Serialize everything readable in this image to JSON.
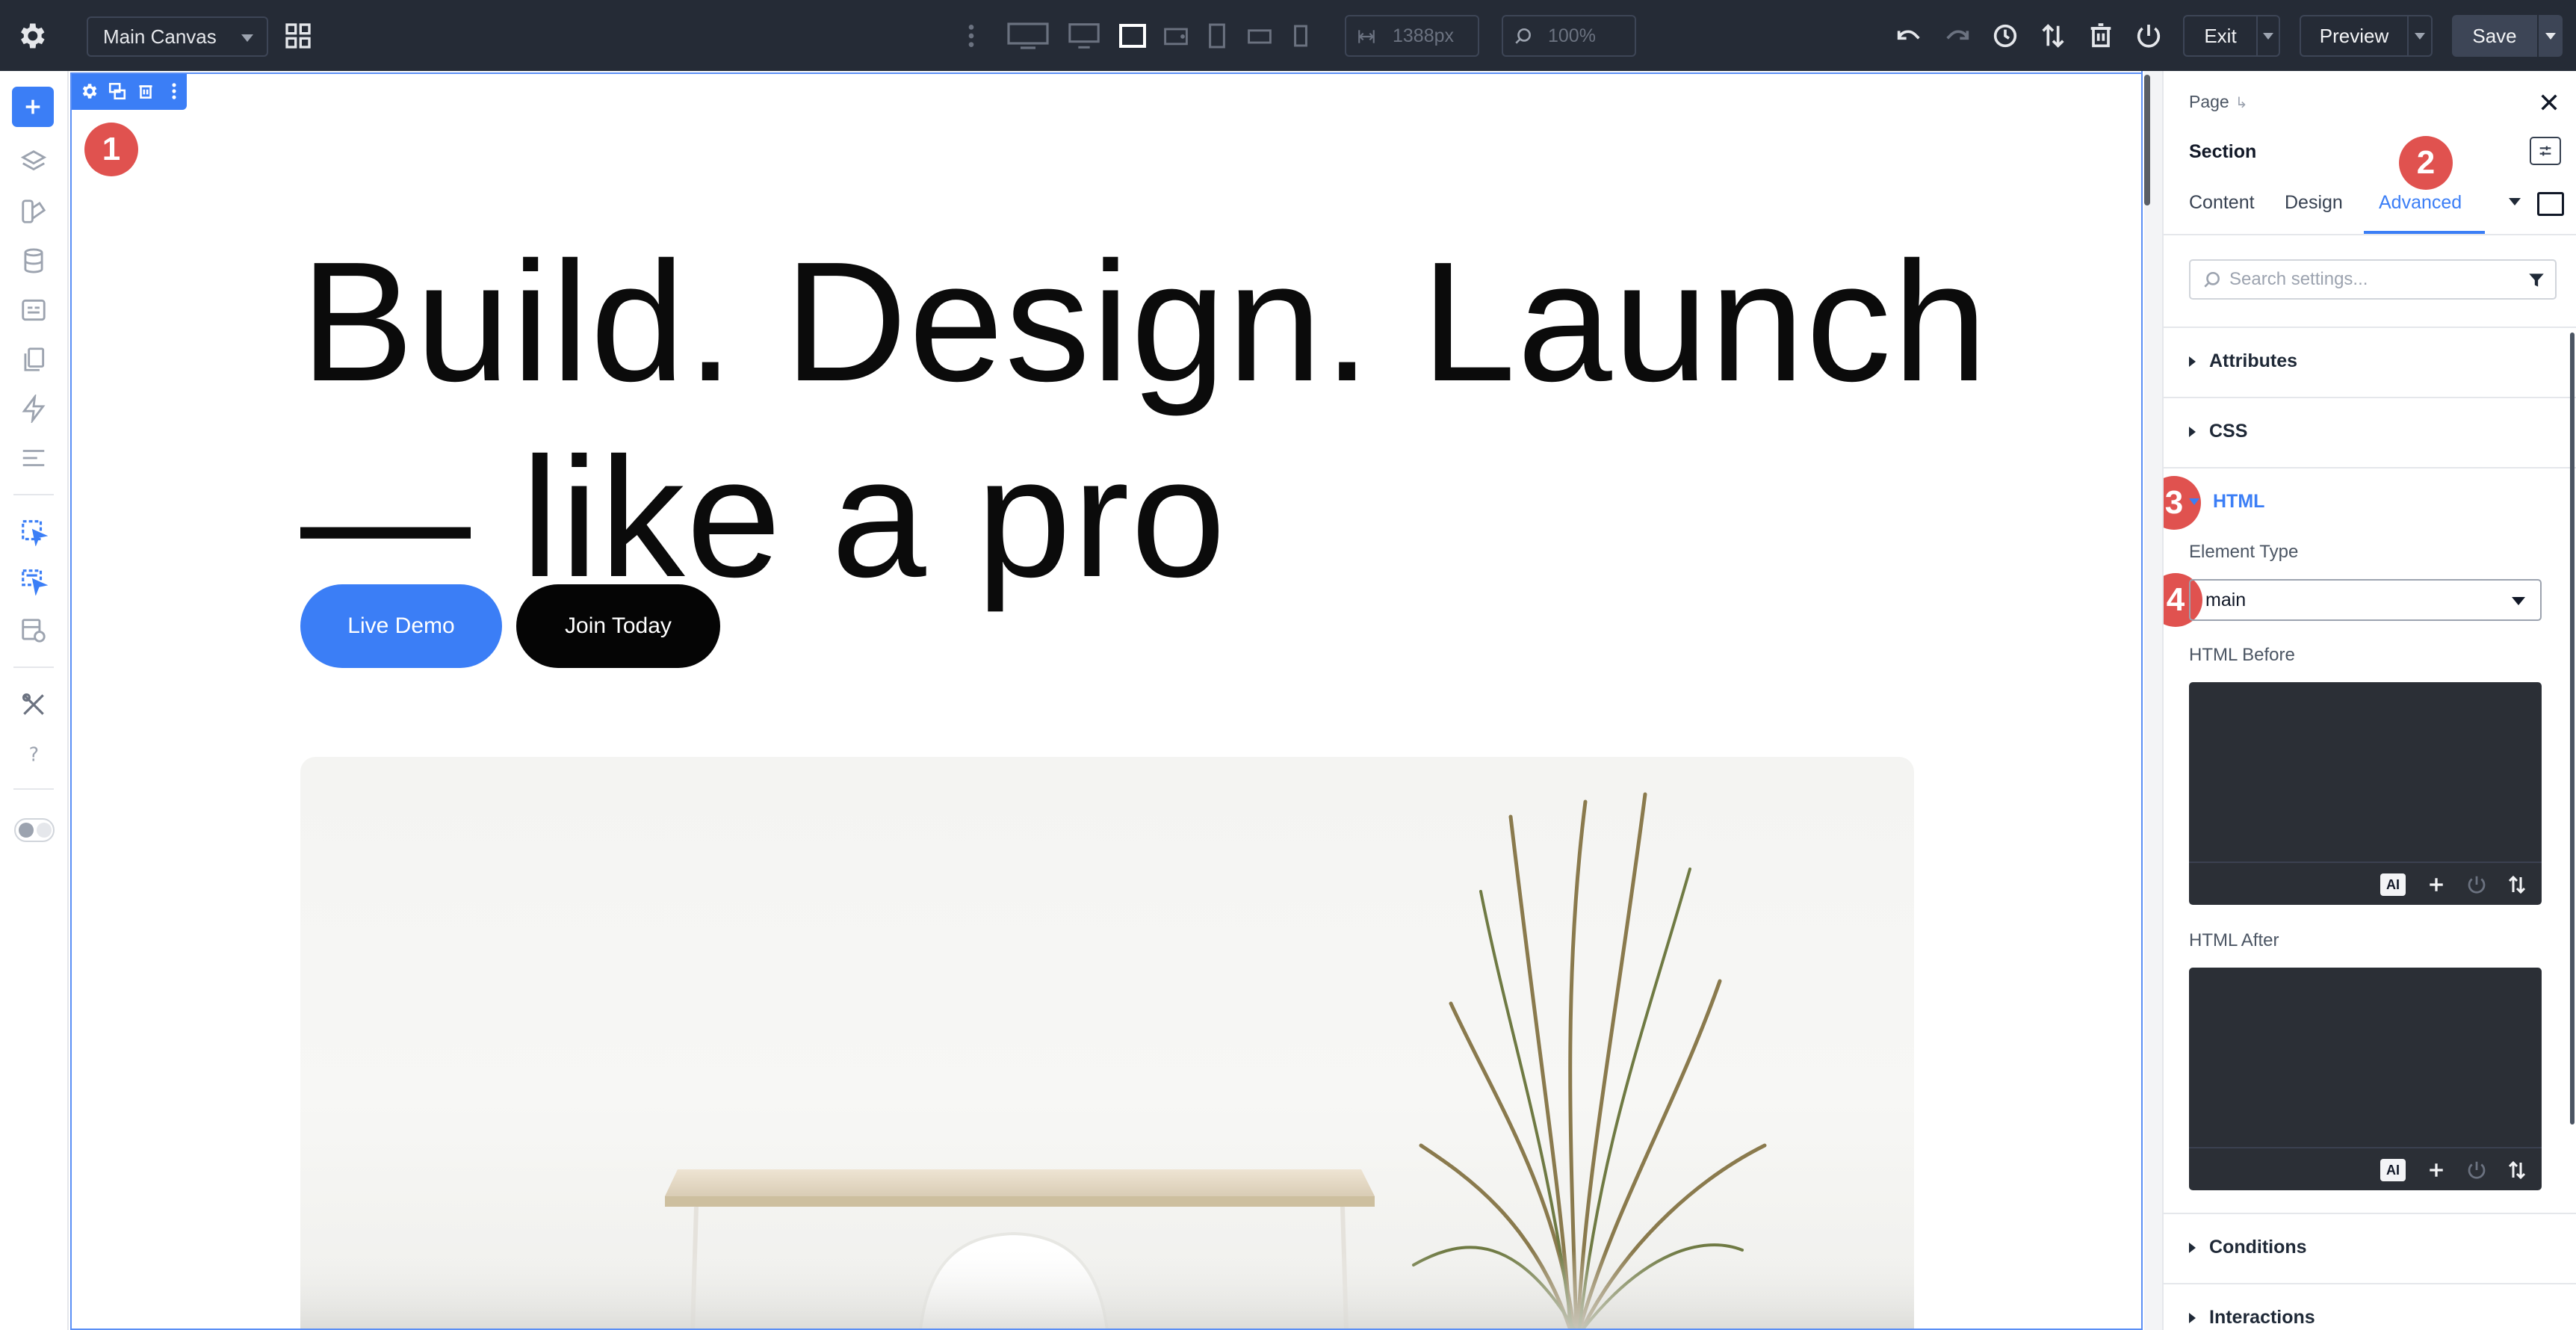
{
  "topbar": {
    "canvas_name": "Main Canvas",
    "width_value": "1388px",
    "zoom_value": "100%",
    "exit_label": "Exit",
    "preview_label": "Preview",
    "save_label": "Save"
  },
  "canvas": {
    "badge_1": "1",
    "headline_line1": "Build. Design. Launch",
    "headline_line2": "— like a pro",
    "primary_cta": "Live Demo",
    "secondary_cta": "Join Today"
  },
  "panel": {
    "breadcrumb": "Page",
    "breadcrumb_arrow": "↳",
    "element_title": "Section",
    "tabs": [
      {
        "label": "Content",
        "active": false
      },
      {
        "label": "Design",
        "active": false
      },
      {
        "label": "Advanced",
        "active": true
      }
    ],
    "search_placeholder": "Search settings...",
    "sections": {
      "attributes": "Attributes",
      "css": "CSS",
      "html": "HTML",
      "conditions": "Conditions",
      "interactions": "Interactions"
    },
    "element_type_label": "Element Type",
    "element_type_value": "main",
    "html_before_label": "HTML Before",
    "html_after_label": "HTML After",
    "ai_label": "AI",
    "badge_2": "2",
    "badge_3": "3",
    "badge_4": "4"
  },
  "colors": {
    "accent": "#3b7ef6",
    "topbar_bg": "#252b36",
    "badge": "#e0524f",
    "editor_bg": "#2b2f36"
  },
  "icons": {
    "topbar": [
      "settings-icon",
      "layout-grid-icon",
      "more-vertical-icon",
      "desktop-xl-icon",
      "desktop-icon",
      "laptop-icon",
      "tablet-landscape-icon",
      "tablet-portrait-icon",
      "mobile-landscape-icon",
      "mobile-portrait-icon",
      "undo-icon",
      "redo-icon",
      "history-icon",
      "sort-icon",
      "trash-icon",
      "power-icon"
    ],
    "sidebar": [
      "add-icon",
      "layers-icon",
      "components-icon",
      "database-icon",
      "forms-icon",
      "pages-icon",
      "interactions-icon",
      "presets-icon",
      "dynamic-data-icon",
      "query-icon",
      "templates-icon",
      "tools-icon",
      "help-icon",
      "theme-toggle"
    ]
  }
}
